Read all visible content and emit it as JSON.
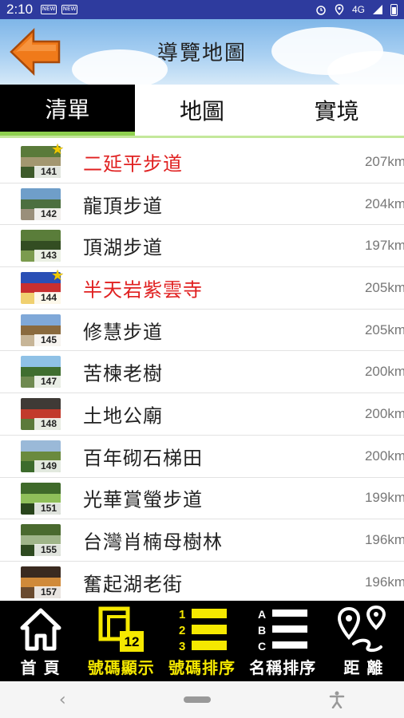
{
  "status_bar": {
    "time": "2:10",
    "badge1": "NEW",
    "badge2": "NEW",
    "network": "4G"
  },
  "header": {
    "title": "導覽地圖"
  },
  "tabs": [
    {
      "label": "清單",
      "active": true
    },
    {
      "label": "地圖",
      "active": false
    },
    {
      "label": "實境",
      "active": false
    }
  ],
  "list": [
    {
      "num": "141",
      "name": "二延平步道",
      "distance": "207km",
      "favorite": true,
      "colors": [
        "#5a7a3a",
        "#a39770",
        "#3d5a2a"
      ]
    },
    {
      "num": "142",
      "name": "龍頂步道",
      "distance": "204km",
      "favorite": false,
      "colors": [
        "#6f9ec9",
        "#4c6f3f",
        "#9a8f7a"
      ]
    },
    {
      "num": "143",
      "name": "頂湖步道",
      "distance": "197km",
      "favorite": false,
      "colors": [
        "#5a7d3a",
        "#334d22",
        "#7b9b4e"
      ]
    },
    {
      "num": "144",
      "name": "半天岩紫雲寺",
      "distance": "205km",
      "favorite": true,
      "colors": [
        "#2a4fb5",
        "#c92f2f",
        "#f0d070"
      ]
    },
    {
      "num": "145",
      "name": "修慧步道",
      "distance": "205km",
      "favorite": false,
      "colors": [
        "#7fa8d8",
        "#8a6a3e",
        "#c7b597"
      ]
    },
    {
      "num": "147",
      "name": "苦楝老樹",
      "distance": "200km",
      "favorite": false,
      "colors": [
        "#8fc1e6",
        "#3f6e2f",
        "#6f8a50"
      ]
    },
    {
      "num": "148",
      "name": "土地公廟",
      "distance": "200km",
      "favorite": false,
      "colors": [
        "#3f3a36",
        "#c23a2c",
        "#5c7a3a"
      ]
    },
    {
      "num": "149",
      "name": "百年砌石梯田",
      "distance": "200km",
      "favorite": false,
      "colors": [
        "#9ab9d8",
        "#6a8a3e",
        "#3c6b2c"
      ]
    },
    {
      "num": "151",
      "name": "光華賞螢步道",
      "distance": "199km",
      "favorite": false,
      "colors": [
        "#3f6a2a",
        "#8fbf5a",
        "#29451c"
      ]
    },
    {
      "num": "155",
      "name": "台灣肖楠母樹林",
      "distance": "196km",
      "favorite": false,
      "colors": [
        "#4a6a2f",
        "#a0b58a",
        "#2e4a20"
      ]
    },
    {
      "num": "157",
      "name": "奮起湖老街",
      "distance": "196km",
      "favorite": false,
      "colors": [
        "#3a2a20",
        "#d08a3a",
        "#6a4a2e"
      ]
    }
  ],
  "toolbar": [
    {
      "label": "首 頁",
      "icon": "home-icon",
      "on": false
    },
    {
      "label": "號碼顯示",
      "icon": "number-display-icon",
      "on": true,
      "badge": "12"
    },
    {
      "label": "號碼排序",
      "icon": "number-sort-icon",
      "on": true,
      "digits": [
        "1",
        "2",
        "3"
      ]
    },
    {
      "label": "名稱排序",
      "icon": "name-sort-icon",
      "on": false,
      "letters": [
        "A",
        "B",
        "C"
      ]
    },
    {
      "label": "距 離",
      "icon": "distance-icon",
      "on": false
    }
  ],
  "colors": {
    "accent_yellow": "#f5e800",
    "favorite_red": "#e02020",
    "tab_active_bg": "#000000",
    "tab_underline": "#8fd14f"
  }
}
